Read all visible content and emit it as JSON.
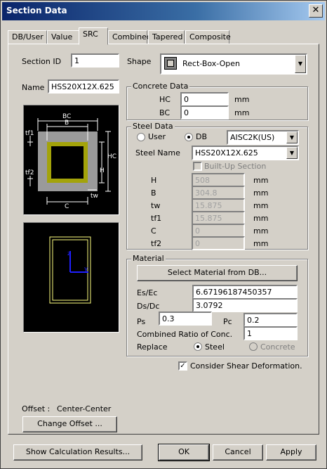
{
  "window": {
    "title": "Section Data",
    "close_glyph": "✕"
  },
  "tabs": [
    "DB/User",
    "Value",
    "SRC",
    "Combined",
    "Tapered",
    "Composite"
  ],
  "section": {
    "id_label": "Section ID",
    "id_value": "1",
    "shape_label": "Shape",
    "shape_value": "Rect-Box-Open",
    "name_label": "Name",
    "name_value": "HSS20X12X.625"
  },
  "concrete": {
    "title": "Concrete Data",
    "hc_label": "HC",
    "hc_value": "0",
    "bc_label": "BC",
    "bc_value": "0",
    "unit": "mm"
  },
  "steel": {
    "title": "Steel Data",
    "user_label": "User",
    "db_label": "DB",
    "db_value": "AISC2K(US)",
    "steel_name_label": "Steel Name",
    "steel_name_value": "HSS20X12X.625",
    "builtup_label": "Built-Up Section",
    "props": [
      {
        "label": "H",
        "value": "508",
        "unit": "mm"
      },
      {
        "label": "B",
        "value": "304.8",
        "unit": "mm"
      },
      {
        "label": "tw",
        "value": "15.875",
        "unit": "mm"
      },
      {
        "label": "tf1",
        "value": "15.875",
        "unit": "mm"
      },
      {
        "label": "C",
        "value": "0",
        "unit": "mm"
      },
      {
        "label": "tf2",
        "value": "0",
        "unit": "mm"
      }
    ]
  },
  "material": {
    "title": "Material",
    "select_btn": "Select Material from DB...",
    "es_label": "Es/Ec",
    "es_value": "6.67196187450357",
    "ds_label": "Ds/Dc",
    "ds_value": "3.0792",
    "ps_label": "Ps",
    "ps_value": "0.3",
    "pc_label": "Pc",
    "pc_value": "0.2",
    "ratio_label": "Combined Ratio of Conc.",
    "ratio_value": "1",
    "replace_label": "Replace",
    "steel_label": "Steel",
    "concrete_label": "Concrete"
  },
  "shear_label": "Consider Shear Deformation.",
  "offset": {
    "label": "Offset :",
    "value": "Center-Center",
    "button": "Change Offset ..."
  },
  "diagram": {
    "bc": "BC",
    "b": "B",
    "hc": "HC",
    "h": "H",
    "tf1": "tf1",
    "tf2": "tf2",
    "c": "C",
    "tw": "tw",
    "axis_y": "y",
    "axis_z": "z"
  },
  "footer": {
    "calc": "Show Calculation Results...",
    "ok": "OK",
    "cancel": "Cancel",
    "apply": "Apply"
  }
}
